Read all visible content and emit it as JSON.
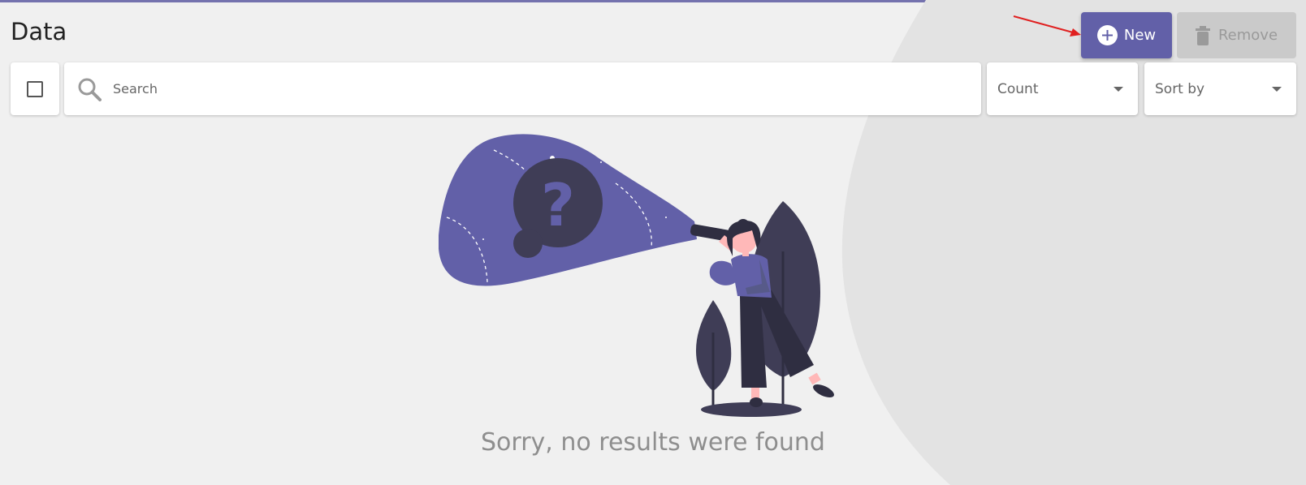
{
  "page": {
    "title": "Data"
  },
  "toolbar": {
    "new_label": "New",
    "remove_label": "Remove"
  },
  "filters": {
    "search_placeholder": "Search",
    "count_label": "Count",
    "sort_label": "Sort by"
  },
  "empty_state": {
    "message": "Sorry, no results were found"
  },
  "icons": {
    "select_all": "checkbox-icon",
    "search": "search-icon",
    "new": "plus-circle-icon",
    "remove": "trash-icon",
    "dropdown": "caret-down-icon"
  },
  "colors": {
    "accent": "#6260a8",
    "disabled": "#cacaca",
    "illustration_dark": "#3f3d56",
    "annotation": "#e02020"
  }
}
